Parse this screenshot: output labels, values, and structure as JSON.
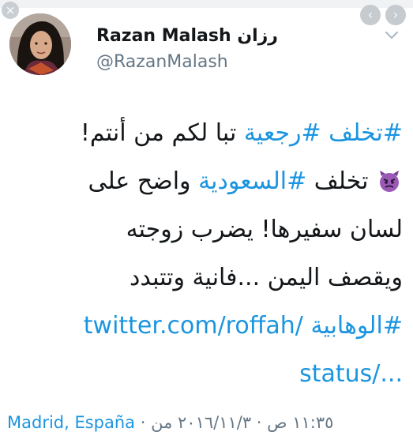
{
  "window": {
    "close_glyph": "×",
    "prev_glyph": "‹",
    "next_glyph": "›"
  },
  "author": {
    "display_name": "Razan Malash رزان",
    "handle": "@RazanMalash",
    "avatar_icon": "user-avatar"
  },
  "tweet": {
    "lines": [
      {
        "parts": [
          {
            "text": "#تخلف",
            "type": "tag"
          },
          {
            "text": " ",
            "type": "text"
          },
          {
            "text": "#رجعية",
            "type": "tag"
          },
          {
            "text": " تبا لكم من أنتم!",
            "type": "text"
          }
        ]
      },
      {
        "parts": [
          {
            "text": "",
            "type": "emoji"
          },
          {
            "text": " تخلف ",
            "type": "text"
          },
          {
            "text": "#السعودية",
            "type": "tag"
          },
          {
            "text": " واضح على",
            "type": "text"
          }
        ]
      },
      {
        "parts": [
          {
            "text": "لسان سفيرها! يضرب زوجته",
            "type": "text"
          }
        ]
      },
      {
        "parts": [
          {
            "text": "ويقصف اليمن ...فانية وتتبدد",
            "type": "text"
          }
        ]
      },
      {
        "parts": [
          {
            "text": "#الوهابية",
            "type": "tag"
          },
          {
            "text": " ",
            "type": "text"
          },
          {
            "text": "twitter.com/roffah/",
            "type": "link"
          }
        ]
      },
      {
        "parts": [
          {
            "text": "status/...",
            "type": "link"
          }
        ]
      }
    ],
    "emoji_icon": "angry-devil-emoji",
    "emoji_color": "#9b59b6"
  },
  "meta": {
    "time": "١١:٣٥ ص",
    "separator": " · ",
    "date": "٢٠١٦/١١/٣ من",
    "place": "Madrid, España"
  },
  "colors": {
    "link": "#1b95e0",
    "muted": "#657786",
    "text": "#14171a"
  }
}
